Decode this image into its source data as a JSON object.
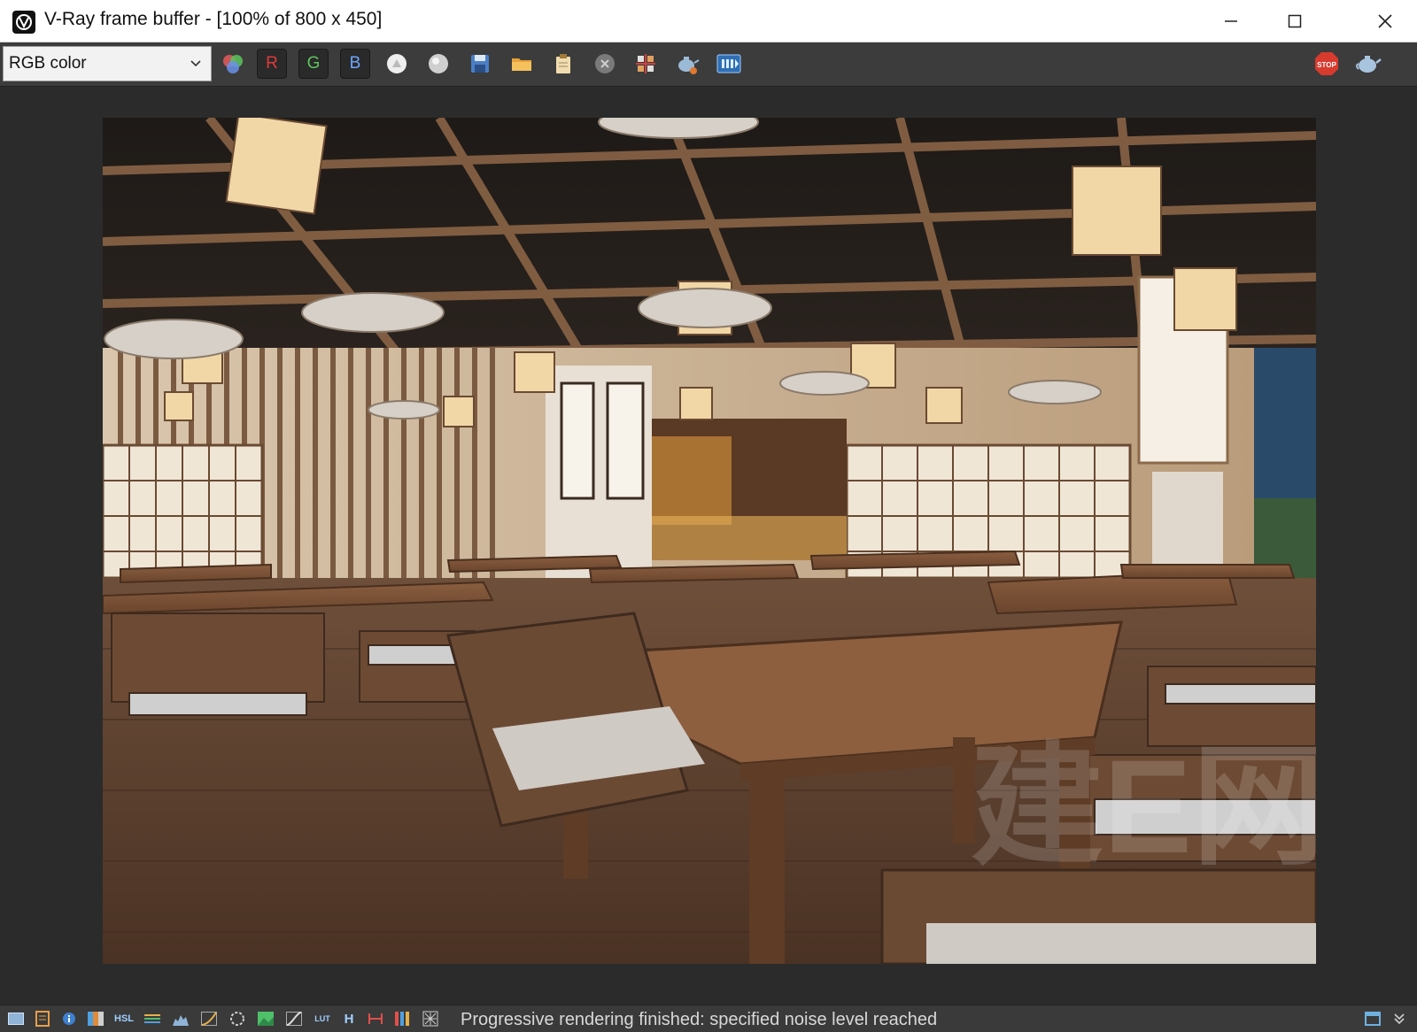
{
  "window": {
    "title": "V-Ray frame buffer - [100% of 800 x 450]",
    "minimize_label": "—",
    "maximize_label": "☐",
    "close_label": "✕"
  },
  "toolbar": {
    "channel_value": "RGB color",
    "red_label": "R",
    "green_label": "G",
    "blue_label": "B",
    "icons": [
      "color-wheel-icon",
      "red-channel",
      "green-channel",
      "blue-channel",
      "alpha-circle-icon",
      "mono-circle-icon",
      "save-icon",
      "open-folder-icon",
      "clipboard-icon",
      "clear-icon",
      "region-render-icon",
      "teapot-render-icon",
      "history-icon",
      "stop-icon",
      "teapot-icon"
    ],
    "stop_label": "STOP"
  },
  "render": {
    "watermark": "建E网"
  },
  "status": {
    "message": "Progressive rendering finished: specified noise level reached",
    "lut_label": "LUT",
    "hsl_label": "HSL",
    "h_label": "H"
  },
  "colors": {
    "accent_red": "#e03a3a",
    "accent_green": "#5ec45e",
    "accent_blue": "#6ea6ff",
    "toolbar_bg": "#3c3c3c",
    "viewport_bg": "#2b2b2b"
  }
}
